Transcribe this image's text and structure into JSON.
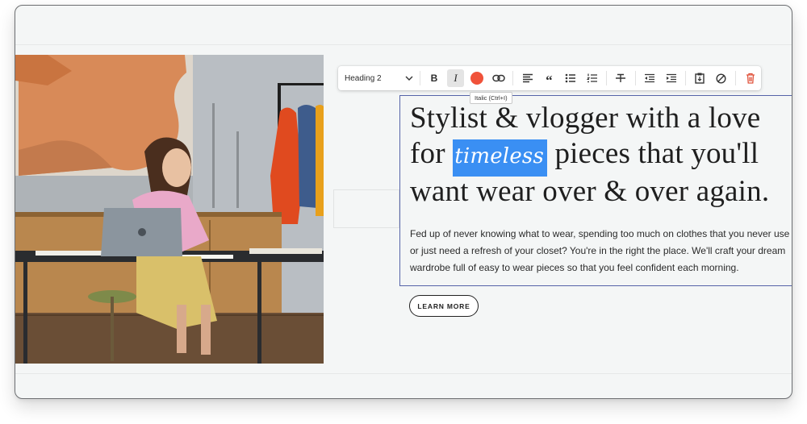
{
  "toolbar": {
    "block_style": "Heading 2",
    "buttons": [
      {
        "name": "bold-button",
        "icon": "bold-icon"
      },
      {
        "name": "italic-button",
        "icon": "italic-icon",
        "active": true
      },
      {
        "name": "text-color-button",
        "icon": "color-swatch-icon"
      },
      {
        "name": "link-button",
        "icon": "link-icon"
      },
      {
        "name": "align-button",
        "icon": "align-left-icon"
      },
      {
        "name": "quote-button",
        "icon": "quote-icon"
      },
      {
        "name": "bulleted-list-button",
        "icon": "bulleted-list-icon"
      },
      {
        "name": "numbered-list-button",
        "icon": "numbered-list-icon"
      },
      {
        "name": "strikethrough-button",
        "icon": "strikethrough-icon"
      },
      {
        "name": "outdent-button",
        "icon": "outdent-icon"
      },
      {
        "name": "indent-button",
        "icon": "indent-icon"
      },
      {
        "name": "paste-button",
        "icon": "clipboard-icon"
      },
      {
        "name": "clear-format-button",
        "icon": "clear-format-icon"
      },
      {
        "name": "delete-button",
        "icon": "trash-icon"
      }
    ],
    "text_color": "#f0523a",
    "delete_color": "#e0523a",
    "tooltip": "Italic (Ctrl+I)"
  },
  "content": {
    "headline_pre": "Stylist & vlogger with a love for ",
    "headline_selected": "timeless",
    "headline_post": " pieces that you'll want wear over & over again.",
    "paragraph": "Fed up of never knowing what to wear, spending too much on clothes that you never use or just need a refresh of your closet? You're in the right the place. We'll craft your dream wardrobe full of easy to wear pieces so that you feel confident each morning.",
    "cta_label": "LEARN MORE"
  },
  "colors": {
    "selection": "#3a8ff3",
    "block_outline": "#5563a8"
  }
}
